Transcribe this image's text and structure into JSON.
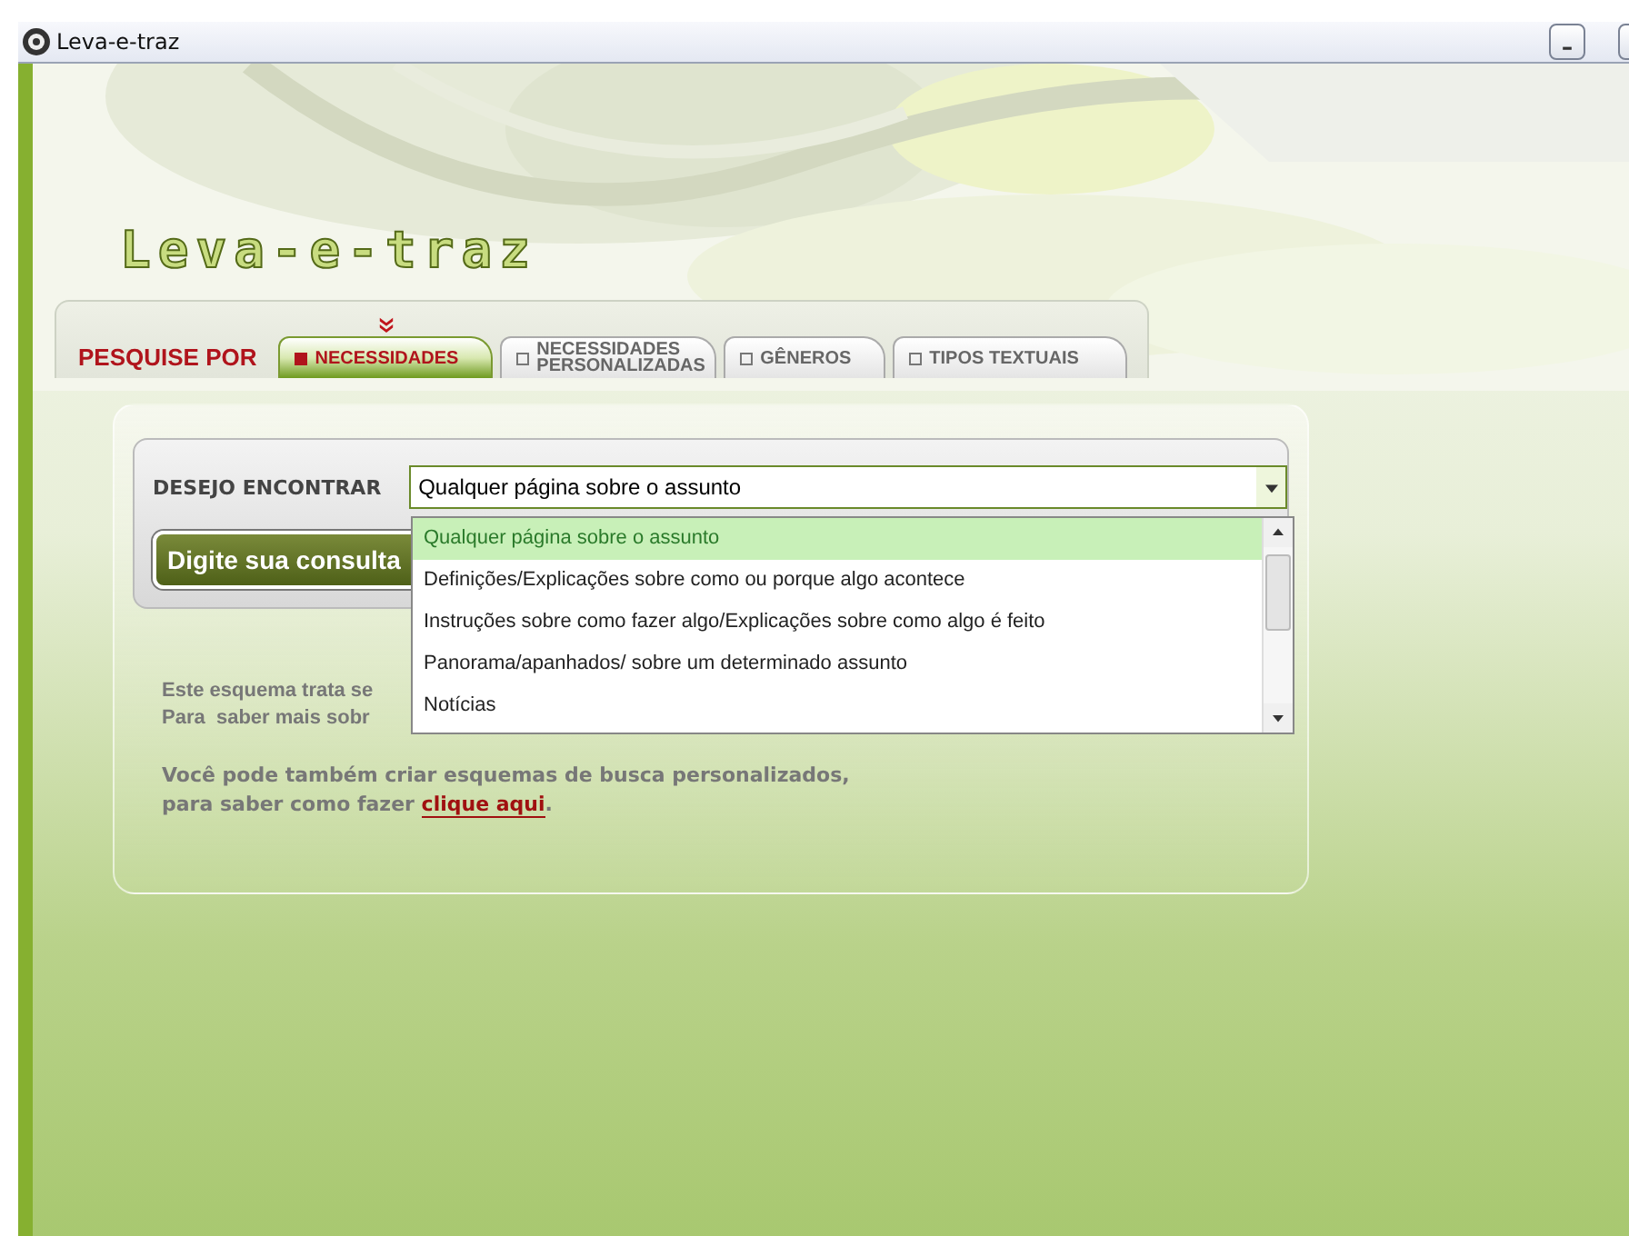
{
  "window": {
    "title": "Leva-e-traz"
  },
  "logo": "Leva-e-traz",
  "search_by": {
    "label": "PESQUISE POR",
    "tabs": [
      {
        "label": "NECESSIDADES",
        "selected": true
      },
      {
        "label": "NECESSIDADES PERSONALIZADAS",
        "selected": false
      },
      {
        "label": "GÊNEROS",
        "selected": false
      },
      {
        "label": "TIPOS TEXTUAIS",
        "selected": false
      }
    ]
  },
  "form": {
    "label": "DESEJO ENCONTRAR",
    "select": {
      "value": "Qualquer página sobre o assunto",
      "expanded": true,
      "options": [
        {
          "label": "Qualquer página sobre o assunto",
          "selected": true
        },
        {
          "label": "Definições/Explicações sobre como ou porque algo acontece",
          "selected": false
        },
        {
          "label": "Instruções sobre como fazer algo/Explicações sobre como algo é feito",
          "selected": false
        },
        {
          "label": "Panorama/apanhados/ sobre um determinado assunto",
          "selected": false
        },
        {
          "label": "Notícias",
          "selected": false
        }
      ]
    },
    "button": "Digite sua consulta"
  },
  "info": [
    "Este esquema trata se",
    "Para  saber mais sobr"
  ],
  "custom_note": {
    "text": "Você pode também criar esquemas de busca personalizados,\npara saber como fazer ",
    "link": "clique aqui",
    "end": "."
  }
}
